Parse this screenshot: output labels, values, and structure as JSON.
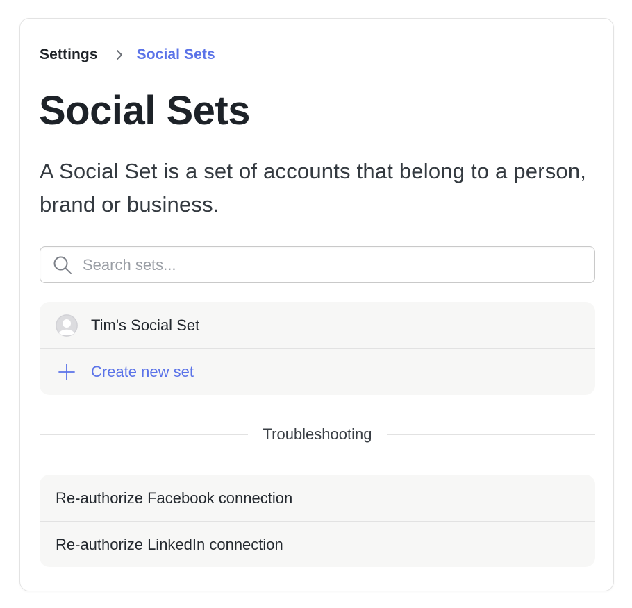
{
  "breadcrumb": {
    "root": "Settings",
    "separator_icon": "chevron-right-icon",
    "current": "Social Sets"
  },
  "page": {
    "title": "Social Sets",
    "description": "A Social Set is a set of accounts that belong to a person, brand or business."
  },
  "search": {
    "placeholder": "Search sets...",
    "value": "",
    "icon": "search-icon"
  },
  "sets": {
    "items": [
      {
        "label": "Tim's Social Set",
        "icon": "avatar-icon"
      }
    ],
    "create_label": "Create new set",
    "create_icon": "plus-icon"
  },
  "troubleshooting": {
    "heading": "Troubleshooting",
    "items": [
      {
        "label": "Re-authorize Facebook connection"
      },
      {
        "label": "Re-authorize LinkedIn connection"
      }
    ]
  },
  "colors": {
    "accent": "#5b73e8",
    "text": "#1f2328",
    "list_bg": "#f7f7f6",
    "border": "#e2e2e2"
  }
}
